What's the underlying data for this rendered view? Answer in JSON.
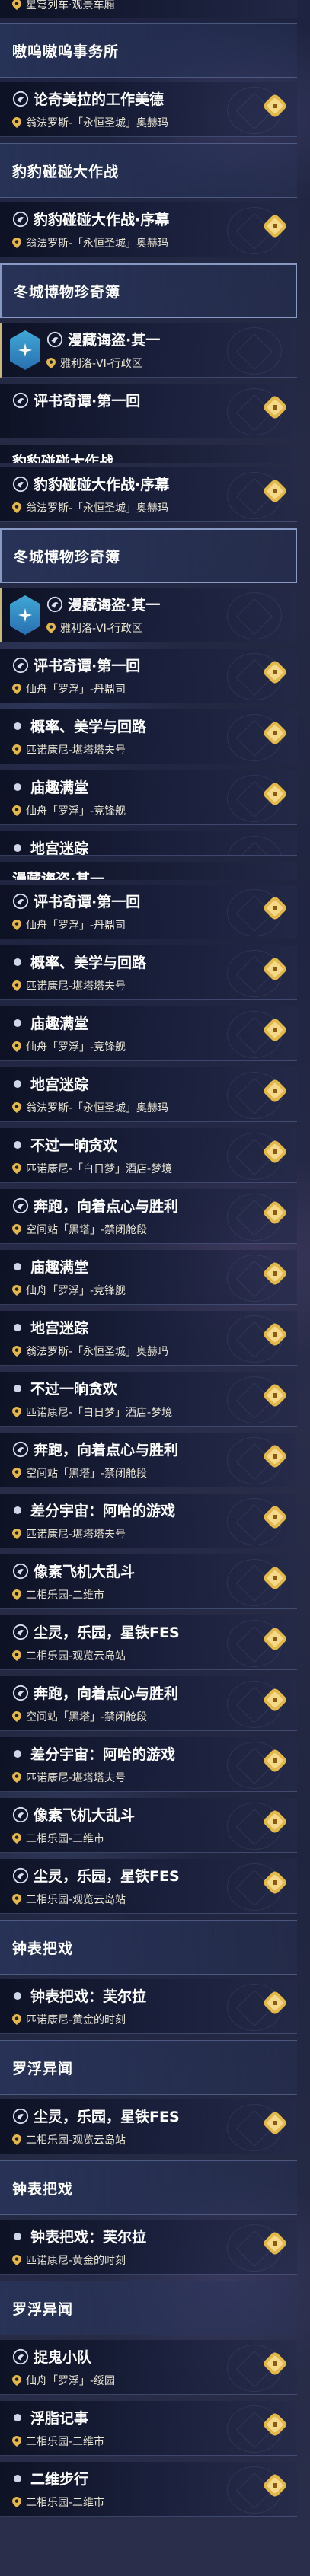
{
  "colors": {
    "accent_gold": "#e2b84a",
    "badge_blue": "#3fa7d6",
    "subtitle": "#e8e4d4"
  },
  "icons": {
    "quest": "quest-scroll-icon",
    "location": "map-pin-icon",
    "new": "new-badge-icon",
    "trailblaze": "trailblaze-badge-icon"
  },
  "entries": [
    {
      "kind": "partial-bottom",
      "title": "",
      "sub": "星穹列车·观景车厢"
    },
    {
      "kind": "header",
      "title": "嗷呜嗷呜事务所"
    },
    {
      "kind": "item",
      "icon": "quest",
      "title": "论奇美拉的工作美德",
      "sub": "翁法罗斯-「永恒圣城」奥赫玛",
      "new": true
    },
    {
      "kind": "header",
      "title": "豹豹碰碰大作战"
    },
    {
      "kind": "item",
      "icon": "quest",
      "title": "豹豹碰碰大作战·序幕",
      "sub": "翁法罗斯-「永恒圣城」奥赫玛",
      "new": true
    },
    {
      "kind": "header",
      "title": "冬城博物珍奇簿",
      "boxed": true
    },
    {
      "kind": "item",
      "icon": "quest",
      "title": "漫藏诲盗·其一",
      "sub": "雅利洛-VI-行政区",
      "badge": true,
      "sel": true
    },
    {
      "kind": "item",
      "icon": "quest",
      "title": "评书奇谭·第一回",
      "sub": "",
      "new": true
    },
    {
      "kind": "partial-top",
      "title": "豹豹碰碰大作战"
    },
    {
      "kind": "item",
      "icon": "quest",
      "title": "豹豹碰碰大作战·序幕",
      "sub": "翁法罗斯-「永恒圣城」奥赫玛",
      "new": true
    },
    {
      "kind": "header",
      "title": "冬城博物珍奇簿",
      "boxed": true
    },
    {
      "kind": "item",
      "icon": "quest",
      "title": "漫藏诲盗·其一",
      "sub": "雅利洛-VI-行政区",
      "badge": true,
      "sel": true
    },
    {
      "kind": "item",
      "icon": "quest",
      "title": "评书奇谭·第一回",
      "sub": "仙舟「罗浮」-丹鼎司",
      "new": true
    },
    {
      "kind": "item",
      "icon": "dot",
      "title": "概率、美学与回路",
      "sub": "匹诺康尼-堪塔塔夫号",
      "new": true
    },
    {
      "kind": "item",
      "icon": "dot",
      "title": "庙趣满堂",
      "sub": "仙舟「罗浮」-竞锋舰",
      "new": true
    },
    {
      "kind": "item",
      "icon": "dot",
      "title": "地宫迷踪",
      "sub": "",
      "cut": true
    },
    {
      "kind": "partial-top",
      "title": "漫藏诲盗·其一"
    },
    {
      "kind": "item",
      "icon": "quest",
      "title": "评书奇谭·第一回",
      "sub": "仙舟「罗浮」-丹鼎司",
      "new": true
    },
    {
      "kind": "item",
      "icon": "dot",
      "title": "概率、美学与回路",
      "sub": "匹诺康尼-堪塔塔夫号",
      "new": true
    },
    {
      "kind": "item",
      "icon": "dot",
      "title": "庙趣满堂",
      "sub": "仙舟「罗浮」-竞锋舰",
      "new": true
    },
    {
      "kind": "item",
      "icon": "dot",
      "title": "地宫迷踪",
      "sub": "翁法罗斯-「永恒圣城」奥赫玛",
      "new": true
    },
    {
      "kind": "item",
      "icon": "dot",
      "title": "不过一晌贪欢",
      "sub": "匹诺康尼-「白日梦」酒店-梦境",
      "new": true
    },
    {
      "kind": "item",
      "icon": "quest",
      "title": "奔跑，向着点心与胜利",
      "sub": "空间站「黑塔」-禁闭舱段",
      "new": true
    },
    {
      "kind": "item",
      "icon": "dot",
      "title": "庙趣满堂",
      "sub": "仙舟「罗浮」-竞锋舰",
      "new": true
    },
    {
      "kind": "item",
      "icon": "dot",
      "title": "地宫迷踪",
      "sub": "翁法罗斯-「永恒圣城」奥赫玛",
      "new": true
    },
    {
      "kind": "item",
      "icon": "dot",
      "title": "不过一晌贪欢",
      "sub": "匹诺康尼-「白日梦」酒店-梦境",
      "new": true
    },
    {
      "kind": "item",
      "icon": "quest",
      "title": "奔跑，向着点心与胜利",
      "sub": "空间站「黑塔」-禁闭舱段",
      "new": true
    },
    {
      "kind": "item",
      "icon": "dot",
      "title": "差分宇宙：阿哈的游戏",
      "sub": "匹诺康尼-堪塔塔夫号",
      "new": true
    },
    {
      "kind": "item",
      "icon": "quest",
      "title": "像素飞机大乱斗",
      "sub": "二相乐园-二维市",
      "new": true
    },
    {
      "kind": "item",
      "icon": "quest",
      "title": "尘灵，乐园，星铁FES",
      "sub": "二相乐园-观览云岛站",
      "new": true
    },
    {
      "kind": "item",
      "icon": "quest",
      "title": "奔跑，向着点心与胜利",
      "sub": "空间站「黑塔」-禁闭舱段",
      "new": true
    },
    {
      "kind": "item",
      "icon": "dot",
      "title": "差分宇宙：阿哈的游戏",
      "sub": "匹诺康尼-堪塔塔夫号",
      "new": true
    },
    {
      "kind": "item",
      "icon": "quest",
      "title": "像素飞机大乱斗",
      "sub": "二相乐园-二维市",
      "new": true
    },
    {
      "kind": "item",
      "icon": "quest",
      "title": "尘灵，乐园，星铁FES",
      "sub": "二相乐园-观览云岛站",
      "new": true
    },
    {
      "kind": "header",
      "title": "钟表把戏"
    },
    {
      "kind": "item",
      "icon": "dot",
      "title": "钟表把戏：芙尔拉",
      "sub": "匹诺康尼-黄金的时刻",
      "new": true
    },
    {
      "kind": "header",
      "title": "罗浮异闻"
    },
    {
      "kind": "item",
      "icon": "quest",
      "title": "尘灵，乐园，星铁FES",
      "sub": "二相乐园-观览云岛站",
      "new": true
    },
    {
      "kind": "header",
      "title": "钟表把戏"
    },
    {
      "kind": "item",
      "icon": "dot",
      "title": "钟表把戏：芙尔拉",
      "sub": "匹诺康尼-黄金的时刻",
      "new": true
    },
    {
      "kind": "header",
      "title": "罗浮异闻"
    },
    {
      "kind": "item",
      "icon": "quest",
      "title": "捉鬼小队",
      "sub": "仙舟「罗浮」-绥园",
      "new": true
    },
    {
      "kind": "item",
      "icon": "dot",
      "title": "浮脂记事",
      "sub": "二相乐园-二维市",
      "new": true
    },
    {
      "kind": "item",
      "icon": "dot",
      "title": "二维步行",
      "sub": "二相乐园-二维市",
      "new": true
    }
  ]
}
